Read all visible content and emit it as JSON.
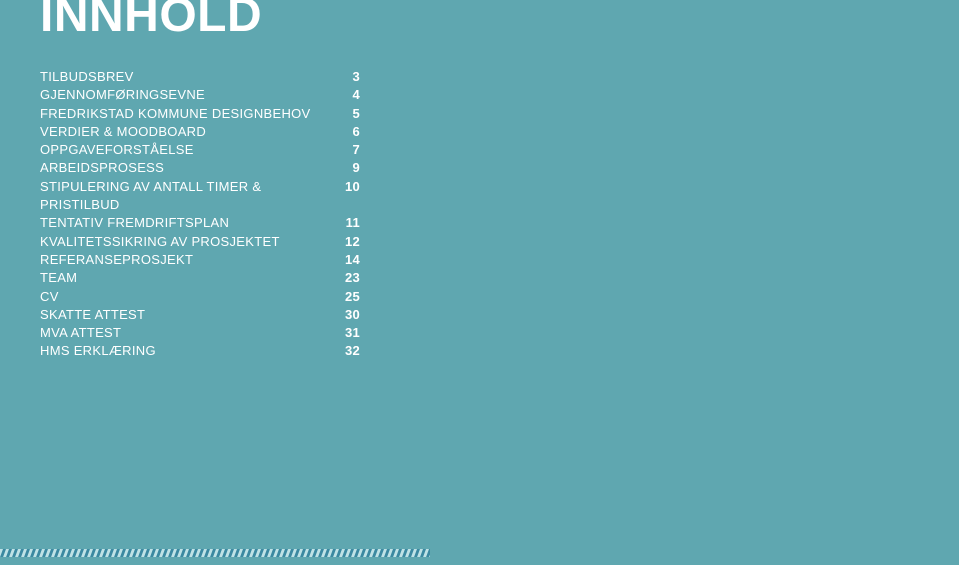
{
  "title": "INNHOLD",
  "toc": [
    {
      "label": "TILBUDSBREV",
      "page": "3"
    },
    {
      "label": "GJENNOMFØRINGSEVNE",
      "page": "4"
    },
    {
      "label": "FREDRIKSTAD KOMMUNE DESIGNBEHOV",
      "page": "5"
    },
    {
      "label": "VERDIER & MOODBOARD",
      "page": "6"
    },
    {
      "label": "OPPGAVEFORSTÅELSE",
      "page": "7"
    },
    {
      "label": "ARBEIDSPROSESS",
      "page": "9"
    },
    {
      "label": "STIPULERING AV ANTALL TIMER & PRISTILBUD",
      "page": "10"
    },
    {
      "label": "TENTATIV FREMDRIFTSPLAN",
      "page": "11"
    },
    {
      "label": "KVALITETSSIKRING AV PROSJEKTET",
      "page": "12"
    },
    {
      "label": "REFERANSEPROSJEKT",
      "page": "14"
    },
    {
      "label": "TEAM",
      "page": "23"
    },
    {
      "label": "CV",
      "page": "25"
    },
    {
      "label": "SKATTE ATTEST",
      "page": "30"
    },
    {
      "label": "MVA ATTEST",
      "page": "31"
    },
    {
      "label": "HMS ERKLÆRING",
      "page": "32"
    }
  ],
  "colors": {
    "background": "#5fa7b0",
    "text": "#ffffff",
    "stripe_a": "#bfe2e6",
    "stripe_b": "#3b89a1"
  }
}
